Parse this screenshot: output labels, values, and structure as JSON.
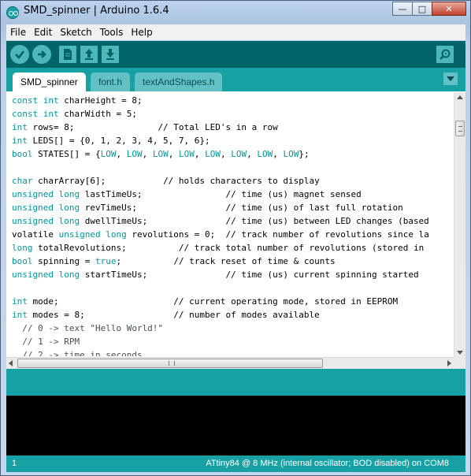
{
  "window": {
    "title": "SMD_spinner | Arduino 1.6.4",
    "minimize_glyph": "—",
    "maximize_glyph": "□",
    "close_glyph": "✕"
  },
  "menu": [
    "File",
    "Edit",
    "Sketch",
    "Tools",
    "Help"
  ],
  "toolbar": {
    "buttons": [
      "verify-icon",
      "upload-icon",
      "new-icon",
      "open-icon",
      "save-icon",
      "serial-monitor-icon"
    ]
  },
  "tabs": [
    {
      "label": "SMD_spinner",
      "active": true
    },
    {
      "label": "font.h",
      "active": false
    },
    {
      "label": "textAndShapes.h",
      "active": false
    }
  ],
  "code_lines": [
    [
      [
        "kw",
        "const int"
      ],
      [
        "t",
        " charHeight = 8;"
      ]
    ],
    [
      [
        "kw",
        "const int"
      ],
      [
        "t",
        " charWidth = 5;"
      ]
    ],
    [
      [
        "kw",
        "int"
      ],
      [
        "t",
        " rows= 8;                // Total LED's in a row"
      ]
    ],
    [
      [
        "kw",
        "int"
      ],
      [
        "t",
        " LEDS[] = {0, 1, 2, 3, 4, 5, 7, 6};"
      ]
    ],
    [
      [
        "kw",
        "bool"
      ],
      [
        "t",
        " STATES[] = {"
      ],
      [
        "lit",
        "LOW"
      ],
      [
        "t",
        ", "
      ],
      [
        "lit",
        "LOW"
      ],
      [
        "t",
        ", "
      ],
      [
        "lit",
        "LOW"
      ],
      [
        "t",
        ", "
      ],
      [
        "lit",
        "LOW"
      ],
      [
        "t",
        ", "
      ],
      [
        "lit",
        "LOW"
      ],
      [
        "t",
        ", "
      ],
      [
        "lit",
        "LOW"
      ],
      [
        "t",
        ", "
      ],
      [
        "lit",
        "LOW"
      ],
      [
        "t",
        ", "
      ],
      [
        "lit",
        "LOW"
      ],
      [
        "t",
        "};"
      ]
    ],
    [
      [
        "t",
        ""
      ]
    ],
    [
      [
        "kw",
        "char"
      ],
      [
        "t",
        " charArray[6];           // holds characters to display"
      ]
    ],
    [
      [
        "kw",
        "unsigned long"
      ],
      [
        "t",
        " lastTimeUs;                // time (us) magnet sensed"
      ]
    ],
    [
      [
        "kw",
        "unsigned long"
      ],
      [
        "t",
        " revTimeUs;                 // time (us) of last full rotation"
      ]
    ],
    [
      [
        "kw",
        "unsigned long"
      ],
      [
        "t",
        " dwellTimeUs;               // time (us) between LED changes (based"
      ]
    ],
    [
      [
        "t",
        "volatile "
      ],
      [
        "kw",
        "unsigned long"
      ],
      [
        "t",
        " revolutions = 0;  // track number of revolutions since la"
      ]
    ],
    [
      [
        "kw",
        "long"
      ],
      [
        "t",
        " totalRevolutions;          // track total number of revolutions (stored in"
      ]
    ],
    [
      [
        "kw",
        "bool"
      ],
      [
        "t",
        " spinning = "
      ],
      [
        "lit",
        "true"
      ],
      [
        "t",
        ";          // track reset of time & counts"
      ]
    ],
    [
      [
        "kw",
        "unsigned long"
      ],
      [
        "t",
        " startTimeUs;               // time (us) current spinning started"
      ]
    ],
    [
      [
        "t",
        ""
      ]
    ],
    [
      [
        "kw",
        "int"
      ],
      [
        "t",
        " mode;                      // current operating mode, stored in EEPROM"
      ]
    ],
    [
      [
        "kw",
        "int"
      ],
      [
        "t",
        " modes = 8;                 // number of modes available"
      ]
    ],
    [
      [
        "t",
        "  // 0 -> text \"Hello World!\""
      ]
    ],
    [
      [
        "t",
        "  // 1 -> RPM"
      ]
    ],
    [
      [
        "t",
        "  // 2 -> time in seconds"
      ]
    ]
  ],
  "colors": {
    "toolbar": "#006468",
    "tabbar": "#17a1a5",
    "keyword": "#00979c",
    "console": "#000000"
  },
  "status": {
    "line": "1",
    "board": "ATtiny84 @ 8 MHz (internal oscillator; BOD disabled) on COM8"
  }
}
